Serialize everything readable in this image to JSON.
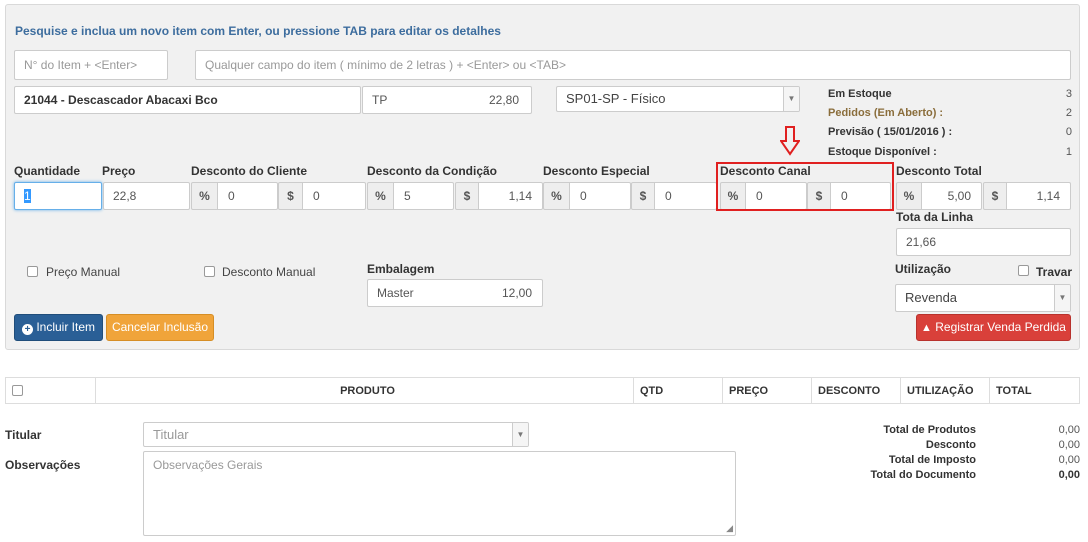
{
  "hint": "Pesquise e inclua um novo item com Enter, ou pressione TAB para editar os detalhes",
  "search": {
    "item_no_placeholder": "N° do Item + <Enter>",
    "any_field_placeholder": "Qualquer campo do item ( mínimo de 2 letras ) + <Enter> ou <TAB>"
  },
  "product": {
    "name": "21044 - Descascador Abacaxi Bco",
    "unit": "TP",
    "price": "22,80",
    "warehouse": "SP01-SP - Físico"
  },
  "stock": {
    "em_estoque_label": "Em Estoque",
    "em_estoque_value": "3",
    "pedidos_label": "Pedidos (Em Aberto) :",
    "pedidos_value": "2",
    "previsao_label": "Previsão ( 15/01/2016 ) :",
    "previsao_value": "0",
    "disponivel_label": "Estoque Disponível :",
    "disponivel_value": "1"
  },
  "fields": {
    "quantidade_label": "Quantidade",
    "quantidade_value": "1",
    "preco_label": "Preço",
    "preco_value": "22,8",
    "desc_cliente_label": "Desconto do Cliente",
    "desc_cliente_pct": "0",
    "desc_cliente_val": "0",
    "desc_condicao_label": "Desconto da Condição",
    "desc_condicao_pct": "5",
    "desc_condicao_val": "1,14",
    "desc_especial_label": "Desconto Especial",
    "desc_especial_pct": "0",
    "desc_especial_val": "0",
    "desc_canal_label": "Desconto Canal",
    "desc_canal_pct": "0",
    "desc_canal_val": "0",
    "desc_total_label": "Desconto Total",
    "desc_total_pct": "5,00",
    "desc_total_val": "1,14",
    "total_linha_label": "Tota da Linha",
    "total_linha_value": "21,66",
    "embalagem_label": "Embalagem",
    "embalagem_name": "Master",
    "embalagem_value": "12,00",
    "utilizacao_label": "Utilização",
    "utilizacao_value": "Revenda",
    "travar_label": "Travar",
    "preco_manual_label": "Preço Manual",
    "desconto_manual_label": "Desconto Manual",
    "pct_symbol": "%",
    "cur_symbol": "$"
  },
  "buttons": {
    "incluir": "Incluir Item",
    "cancelar": "Cancelar Inclusão",
    "registrar": "Registrar Venda Perdida"
  },
  "table": {
    "columns": [
      "PRODUTO",
      "QTD",
      "PREÇO",
      "DESCONTO",
      "UTILIZAÇÃO",
      "TOTAL"
    ]
  },
  "footer": {
    "titular_label": "Titular",
    "titular_placeholder": "Titular",
    "observacoes_label": "Observações",
    "observacoes_placeholder": "Observações Gerais",
    "totals": [
      {
        "label": "Total de Produtos",
        "value": "0,00"
      },
      {
        "label": "Desconto",
        "value": "0,00"
      },
      {
        "label": "Total de Imposto",
        "value": "0,00"
      },
      {
        "label": "Total do Documento",
        "value": "0,00"
      }
    ]
  },
  "colors": {
    "primary": "#2a5f96",
    "warning": "#f0a43a",
    "danger": "#d9403a",
    "highlight": "#e02020",
    "hint": "#3d6d9e"
  },
  "icons": {
    "incluir": "plus-circle-icon",
    "registrar": "warning-icon",
    "annotation": "down-arrow-icon"
  }
}
